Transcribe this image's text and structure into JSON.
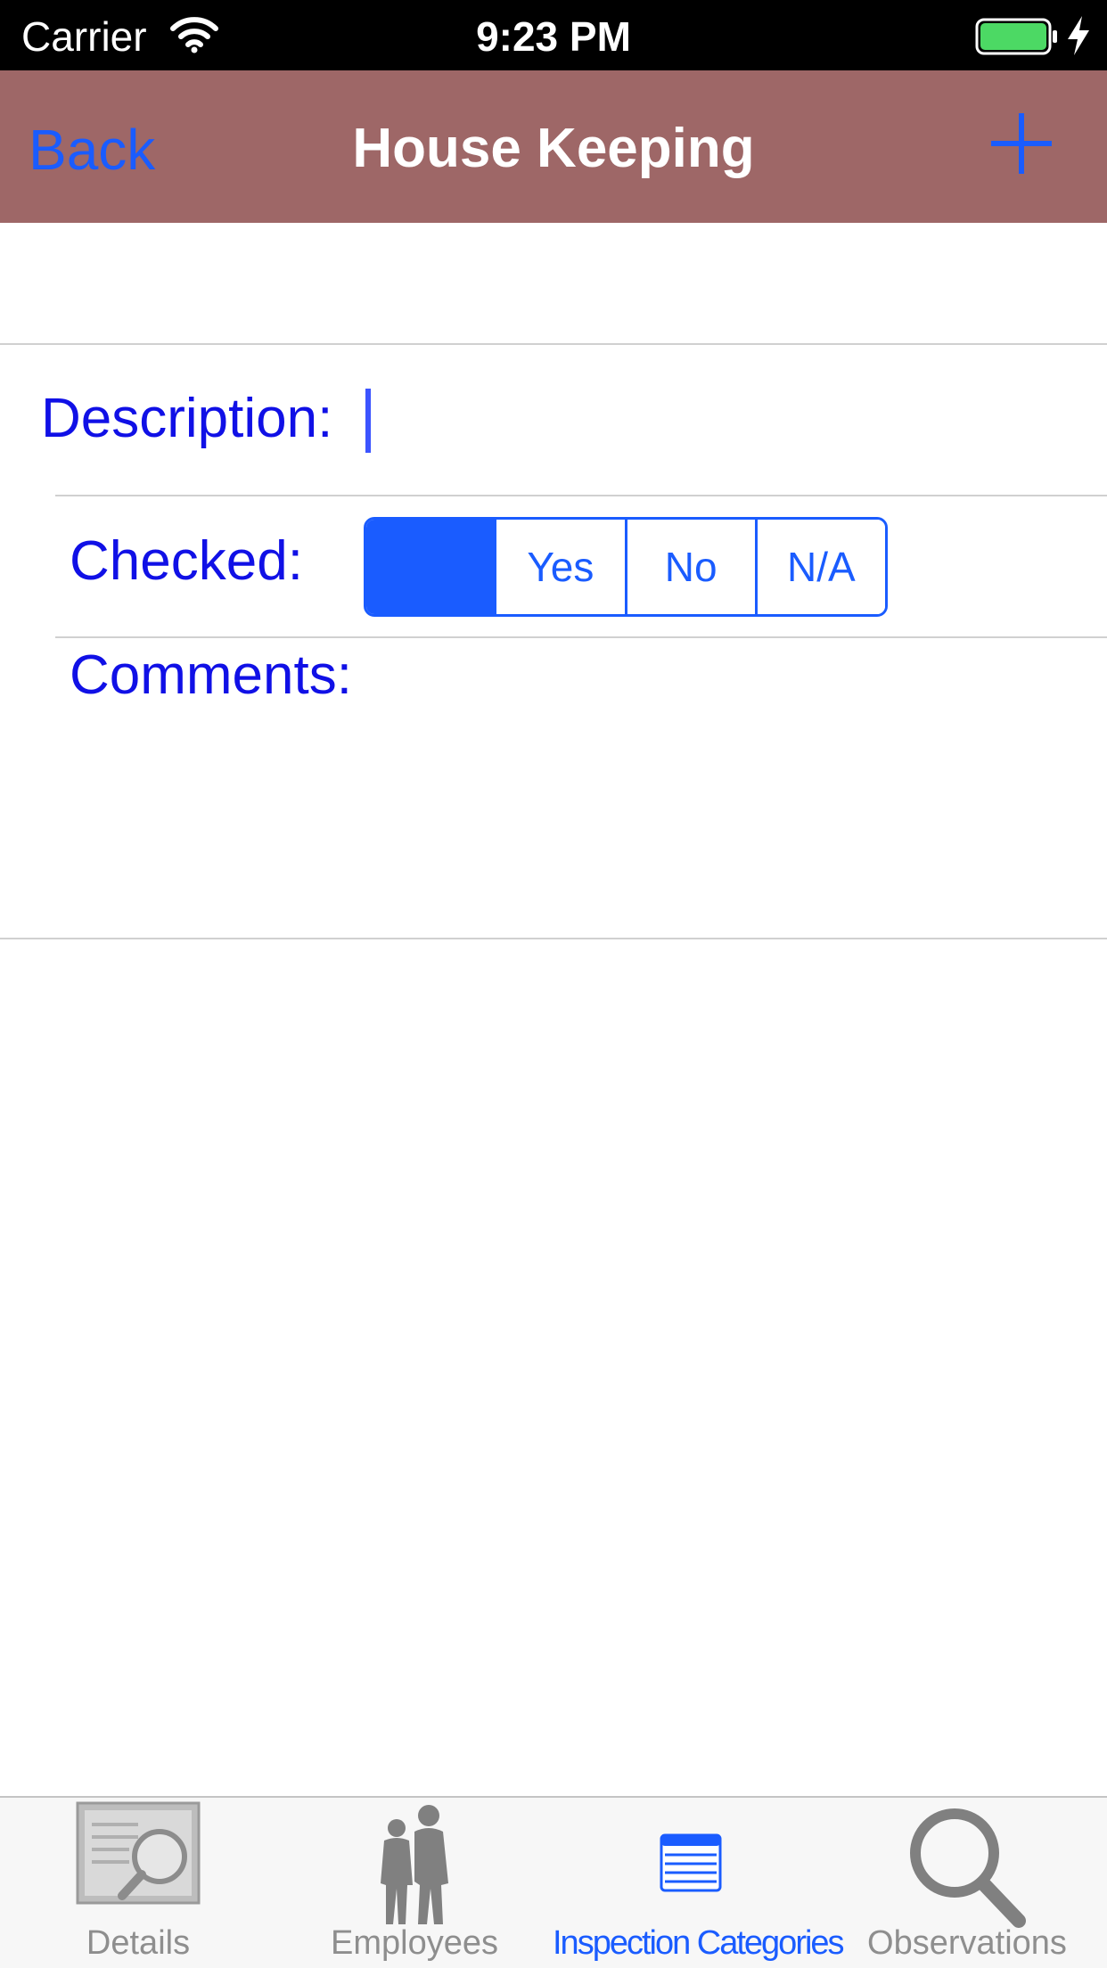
{
  "status_bar": {
    "carrier": "Carrier",
    "time": "9:23 PM",
    "icons": [
      "wifi-icon",
      "battery-icon",
      "charging-icon"
    ],
    "battery_color": "#4cd964"
  },
  "nav": {
    "back_label": "Back",
    "title": "House Keeping",
    "add_icon": "plus-icon",
    "bar_color": "#9e6767",
    "tint_color": "#1a5cff"
  },
  "form": {
    "description_label": "Description:",
    "description_value": "",
    "checked_label": "Checked:",
    "checked_options": [
      "",
      "Yes",
      "No",
      "N/A"
    ],
    "checked_selected_index": 0,
    "comments_label": "Comments:",
    "comments_value": "",
    "label_color": "#1010e6"
  },
  "tab_bar": {
    "tabs": [
      {
        "label": "Details",
        "icon": "details-magnifier-icon",
        "active": false
      },
      {
        "label": "Employees",
        "icon": "employees-silhouette-icon",
        "active": false
      },
      {
        "label": "Inspection Categories",
        "icon": "list-icon",
        "active": true
      },
      {
        "label": "Observations",
        "icon": "search-icon",
        "active": false
      }
    ]
  }
}
